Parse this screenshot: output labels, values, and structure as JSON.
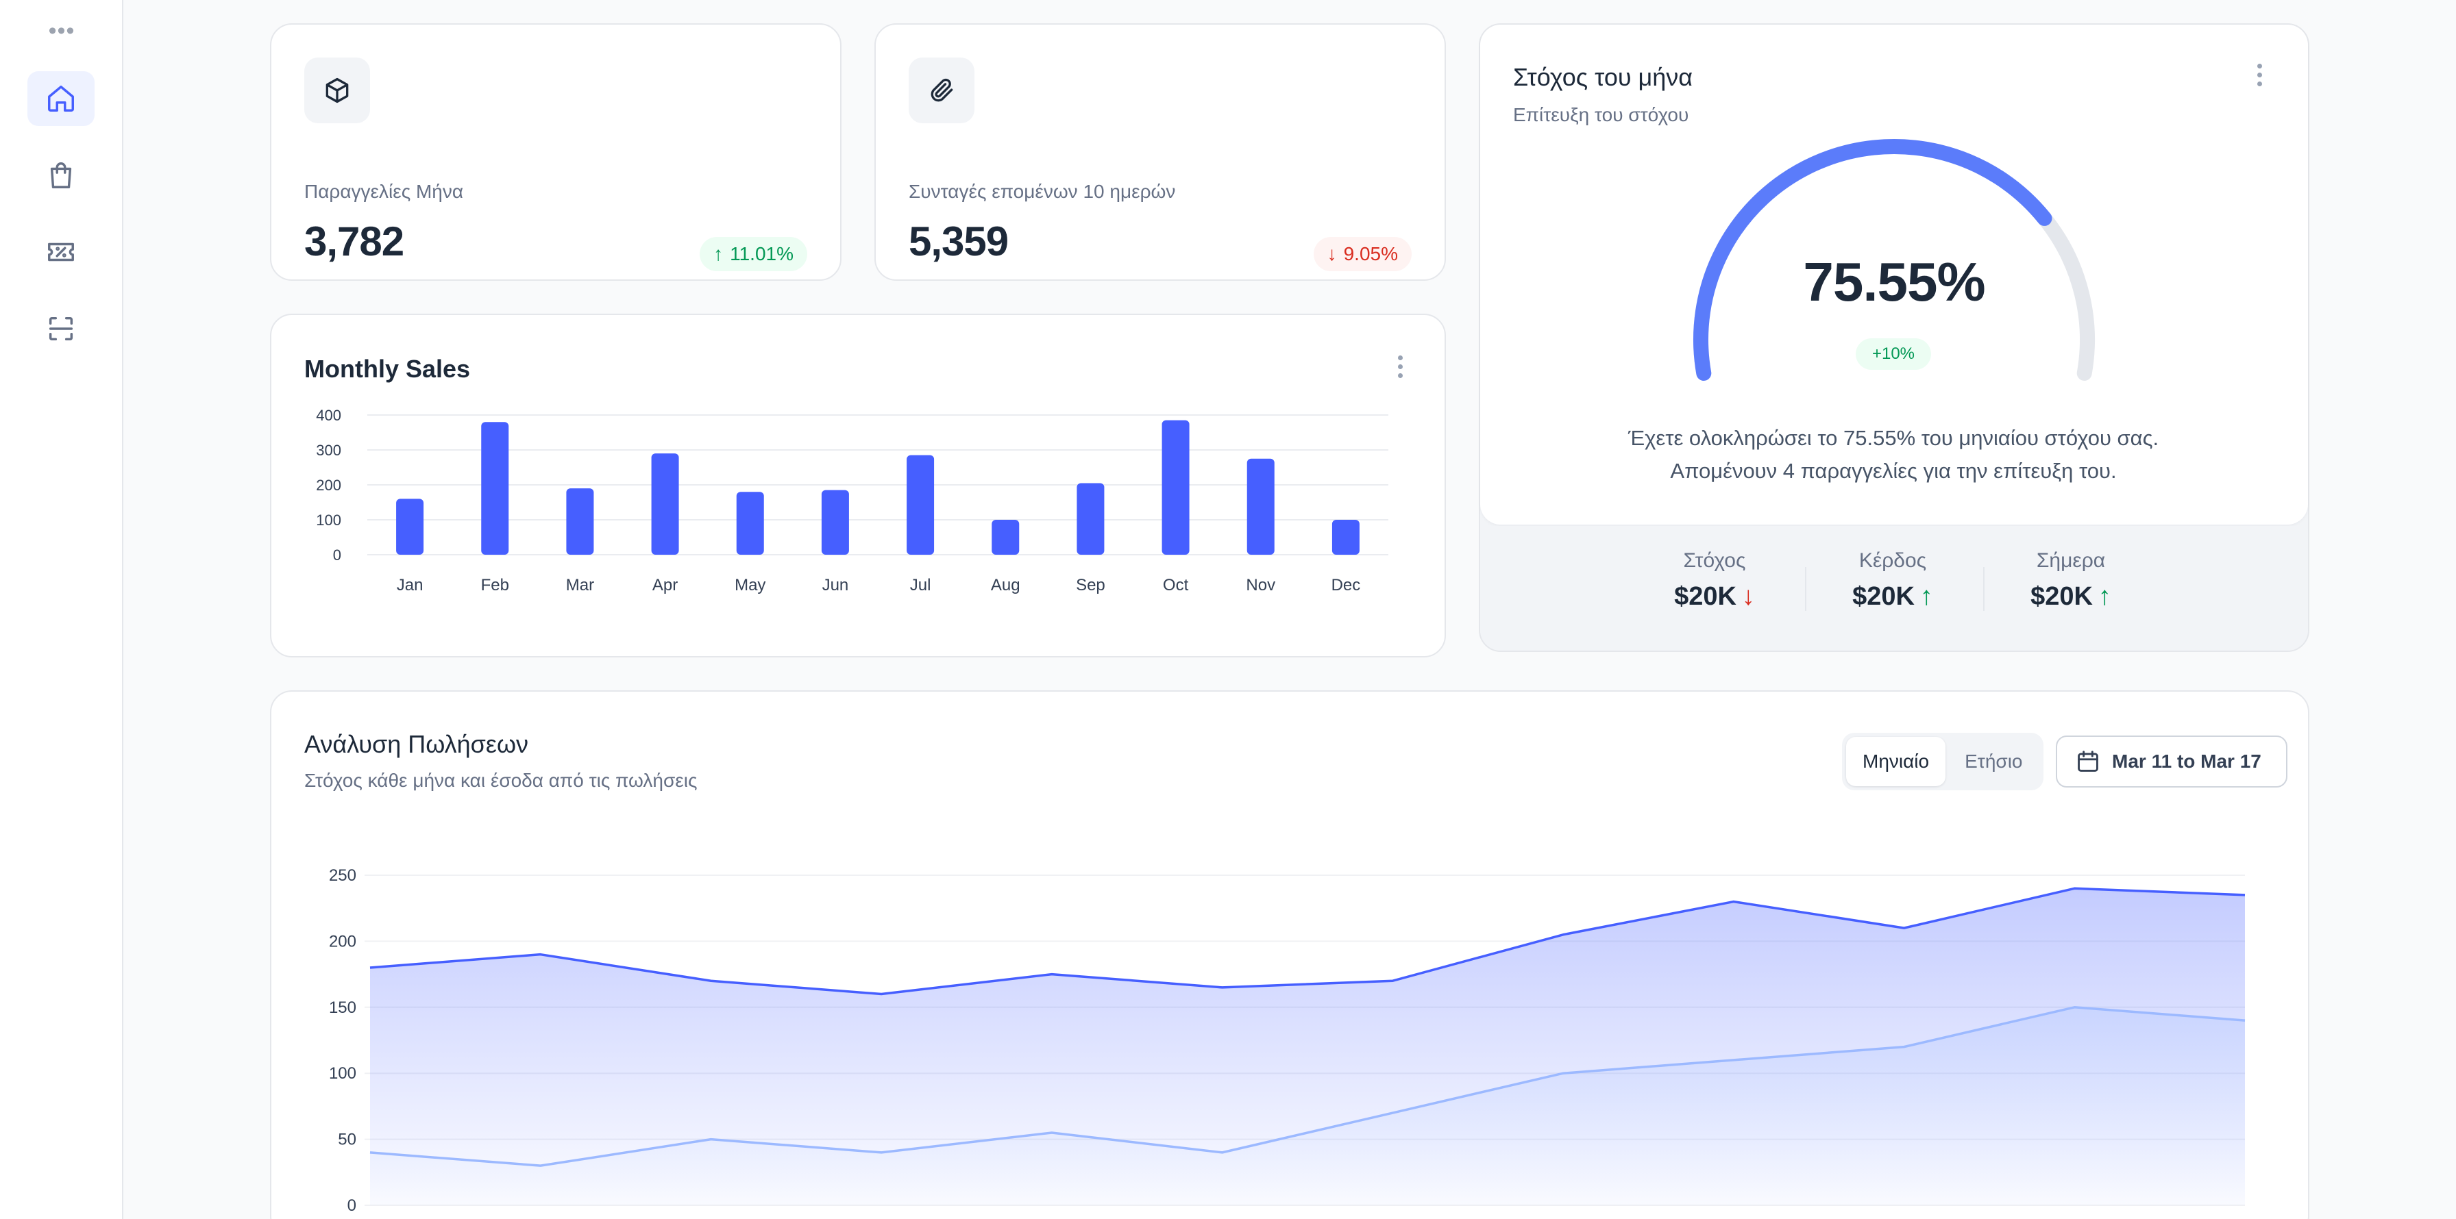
{
  "sidebar": {
    "items": [
      {
        "icon": "home-icon",
        "active": true
      },
      {
        "icon": "shopping-bag-icon",
        "active": false
      },
      {
        "icon": "ticket-icon",
        "active": false
      },
      {
        "icon": "scan-icon",
        "active": false
      }
    ]
  },
  "metrics": [
    {
      "label": "Παραγγελίες Μήνα",
      "value": "3,782",
      "change": "11.01%",
      "direction": "up",
      "icon": "box-icon"
    },
    {
      "label": "Συνταγές επομένων 10 ημερών",
      "value": "5,359",
      "change": "9.05%",
      "direction": "down",
      "icon": "paperclip-icon"
    }
  ],
  "monthly_sales": {
    "title": "Monthly Sales"
  },
  "target": {
    "title": "Στόχος του μήνα",
    "subtitle": "Επίτευξη του στόχου",
    "percent_label": "75.55%",
    "percent": 75.55,
    "badge": "+10%",
    "message": "Έχετε ολοκληρώσει το 75.55% του μηνιαίου στόχου σας. Απομένουν 4 παραγγελίες για την επίτευξη του.",
    "footer": [
      {
        "label": "Στόχος",
        "value": "$20K",
        "direction": "down"
      },
      {
        "label": "Κέρδος",
        "value": "$20K",
        "direction": "up"
      },
      {
        "label": "Σήμερα",
        "value": "$20K",
        "direction": "up"
      }
    ]
  },
  "analysis": {
    "title": "Ανάλυση Πωλήσεων",
    "subtitle": "Στόχος κάθε μήνα και έσοδα από τις πωλήσεις",
    "tabs": [
      "Μηνιαίο",
      "Ετήσιο"
    ],
    "active_tab": "Μηνιαίο",
    "date_range": "Mar 11 to Mar 17"
  },
  "colors": {
    "accent": "#465fff",
    "light_series": "#9cb9ff",
    "up": "#039855",
    "down": "#d92d20"
  },
  "chart_data": [
    {
      "type": "bar",
      "title": "Monthly Sales",
      "categories": [
        "Jan",
        "Feb",
        "Mar",
        "Apr",
        "May",
        "Jun",
        "Jul",
        "Aug",
        "Sep",
        "Oct",
        "Nov",
        "Dec"
      ],
      "values": [
        160,
        380,
        190,
        290,
        180,
        185,
        285,
        100,
        205,
        385,
        275,
        100
      ],
      "yticks": [
        0,
        100,
        200,
        300,
        400
      ],
      "ylim": [
        0,
        400
      ],
      "grid": true
    },
    {
      "type": "area",
      "title": "Ανάλυση Πωλήσεων",
      "x_count": 12,
      "series": [
        {
          "values": [
            180,
            190,
            170,
            160,
            175,
            165,
            170,
            205,
            230,
            210,
            240,
            235
          ]
        },
        {
          "values": [
            40,
            30,
            50,
            40,
            55,
            40,
            70,
            100,
            110,
            120,
            150,
            140
          ]
        }
      ],
      "yticks": [
        0,
        50,
        100,
        150,
        200,
        250
      ],
      "ylim": [
        0,
        250
      ],
      "grid": true
    }
  ]
}
